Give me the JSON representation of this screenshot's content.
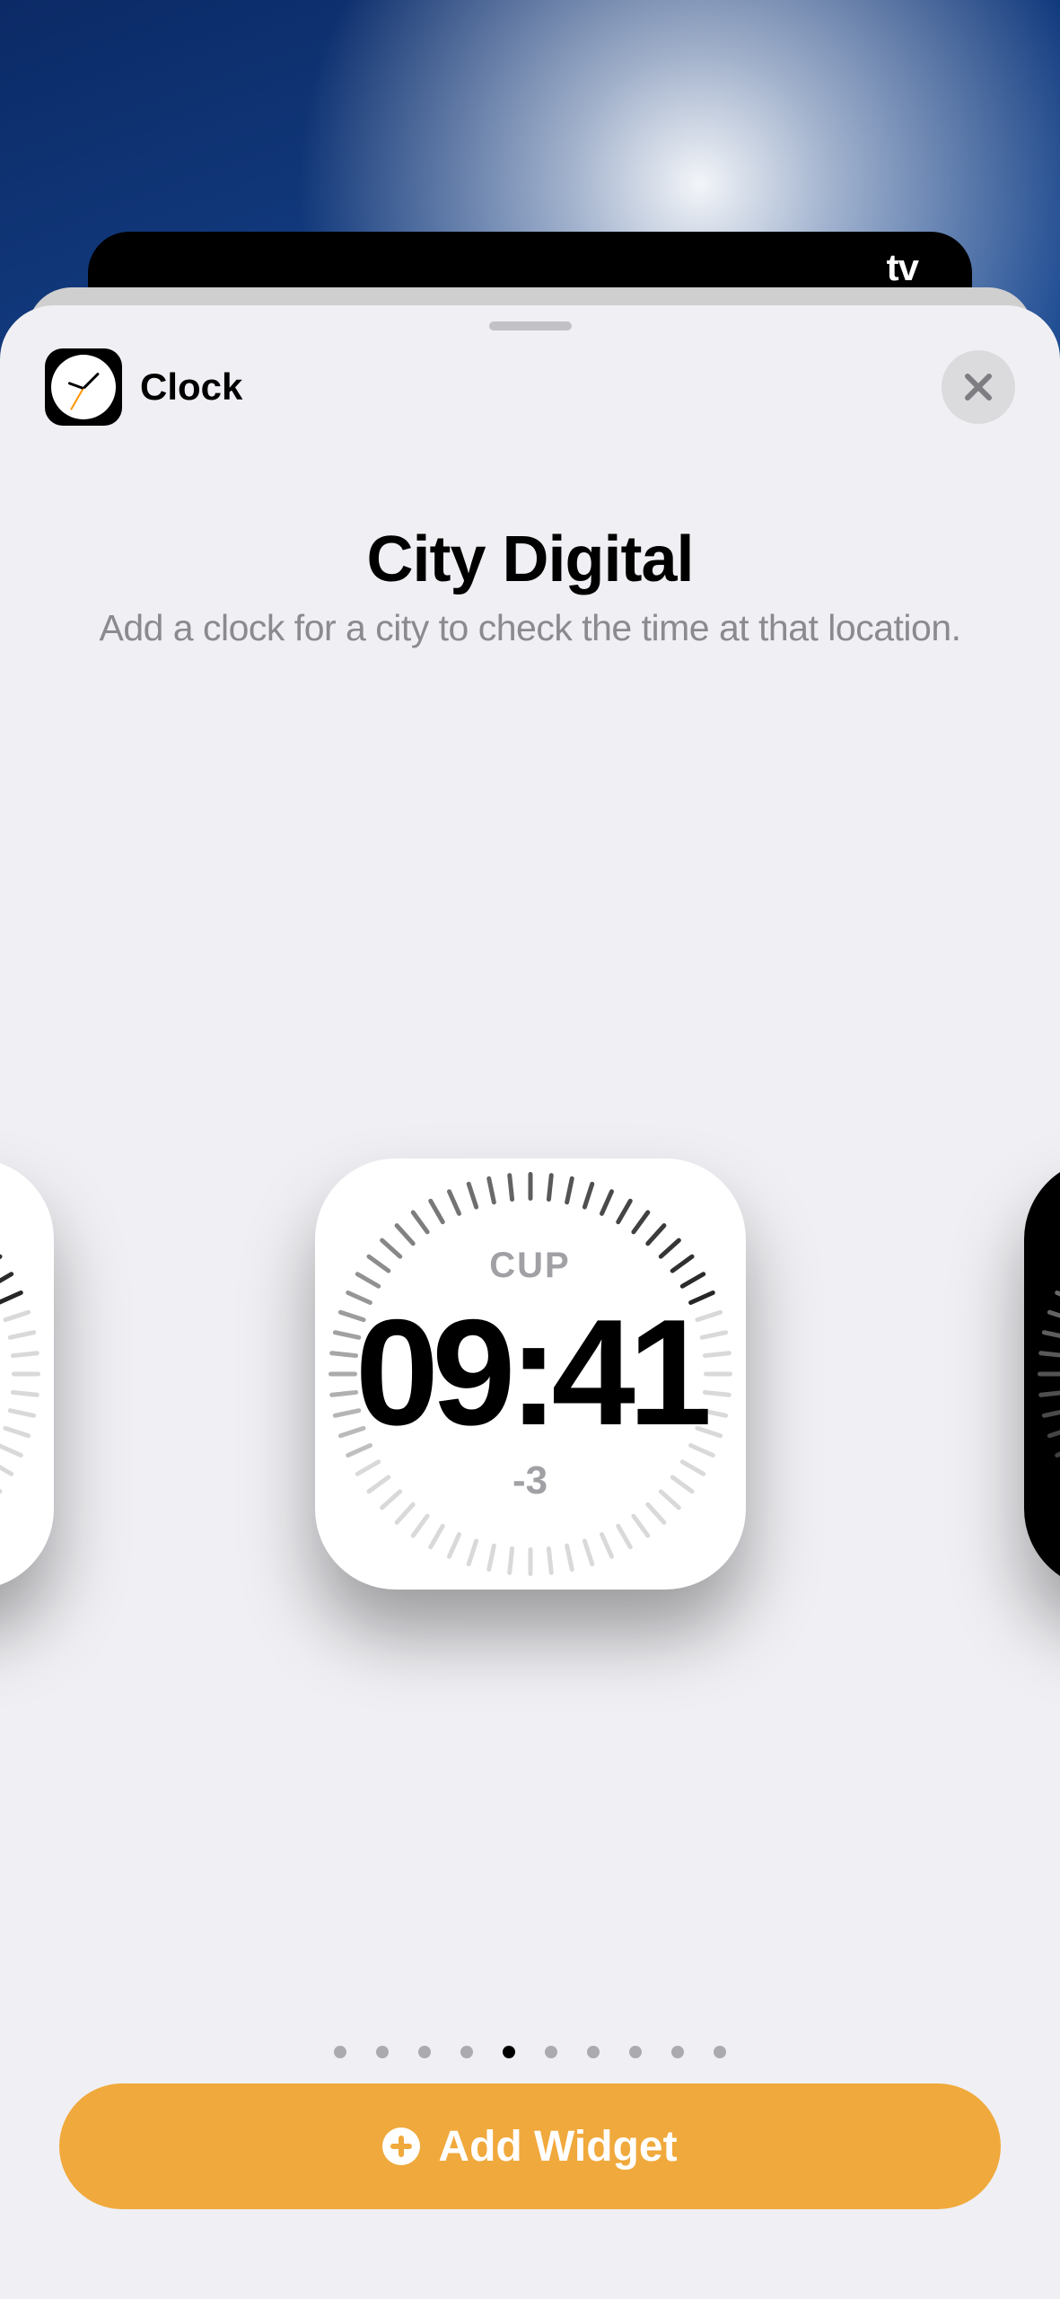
{
  "header": {
    "app_name": "Clock",
    "back_stack_logo": "tv"
  },
  "title": "City Digital",
  "subtitle": "Add a clock for a city to check the time at that location.",
  "widget": {
    "city_abbr": "CUP",
    "time": "09:41",
    "offset": "-3"
  },
  "pager": {
    "total": 10,
    "current": 5
  },
  "buttons": {
    "add_widget": "Add Widget"
  },
  "colors": {
    "accent": "#F0A93C",
    "sheet_bg": "#F0F0F4",
    "text_secondary": "#8A8A8F"
  }
}
